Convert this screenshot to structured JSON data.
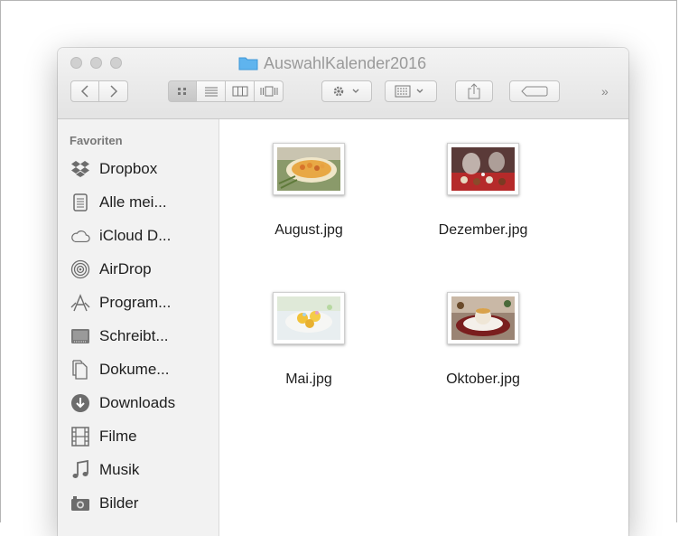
{
  "window": {
    "title": "AuswahlKalender2016"
  },
  "toolbar": {
    "back": "<",
    "forward": ">",
    "more": "»"
  },
  "sidebar": {
    "heading": "Favoriten",
    "items": [
      {
        "label": "Dropbox",
        "icon": "dropbox-icon"
      },
      {
        "label": "Alle mei...",
        "icon": "all-files-icon"
      },
      {
        "label": "iCloud D...",
        "icon": "cloud-icon"
      },
      {
        "label": "AirDrop",
        "icon": "airdrop-icon"
      },
      {
        "label": "Program...",
        "icon": "applications-icon"
      },
      {
        "label": "Schreibt...",
        "icon": "desktop-icon"
      },
      {
        "label": "Dokume...",
        "icon": "document-icon"
      },
      {
        "label": "Downloads",
        "icon": "download-icon"
      },
      {
        "label": "Filme",
        "icon": "film-icon"
      },
      {
        "label": "Musik",
        "icon": "music-icon"
      },
      {
        "label": "Bilder",
        "icon": "camera-icon"
      }
    ]
  },
  "files": [
    {
      "name": "August.jpg"
    },
    {
      "name": "Dezember.jpg"
    },
    {
      "name": "Mai.jpg"
    },
    {
      "name": "Oktober.jpg"
    }
  ]
}
